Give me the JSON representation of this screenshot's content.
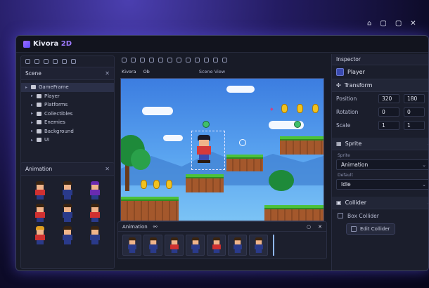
{
  "app": {
    "title_main": "Kivora",
    "title_accent": "2D"
  },
  "scene_panel": {
    "title": "Scene",
    "items": [
      {
        "label": "GameFrame",
        "selected": true,
        "child": false
      },
      {
        "label": "Player",
        "selected": false,
        "child": true
      },
      {
        "label": "Platforms",
        "selected": false,
        "child": true
      },
      {
        "label": "Collectibles",
        "selected": false,
        "child": true
      },
      {
        "label": "Enemies",
        "selected": false,
        "child": true
      },
      {
        "label": "Background",
        "selected": false,
        "child": true
      },
      {
        "label": "UI",
        "selected": false,
        "child": true
      }
    ]
  },
  "assets_panel": {
    "title": "Animation"
  },
  "viewport": {
    "tab_label": "Kivora",
    "tab_label2": "Ob",
    "scene_label": "Scene View"
  },
  "animation_panel": {
    "title": "Animation"
  },
  "inspector": {
    "title": "Inspector",
    "node_name": "Player",
    "transform": {
      "title": "Transform",
      "position_label": "Position",
      "position_x": "320",
      "position_y": "180",
      "rotation_label": "Rotation",
      "rotation_x": "0",
      "rotation_y": "0",
      "scale_label": "Scale",
      "scale_x": "1",
      "scale_y": "1"
    },
    "sprite": {
      "title": "Sprite",
      "type_label": "Sprite",
      "type_value": "Animation",
      "state_label": "Default",
      "state_value": "Idle"
    },
    "collider": {
      "title": "Collider",
      "box_label": "Box Collider",
      "edit_label": "Edit Collider"
    }
  },
  "colors": {
    "accent": "#9f7bff",
    "panel": "#1c1f2d",
    "selected_row": "#2b3048"
  }
}
